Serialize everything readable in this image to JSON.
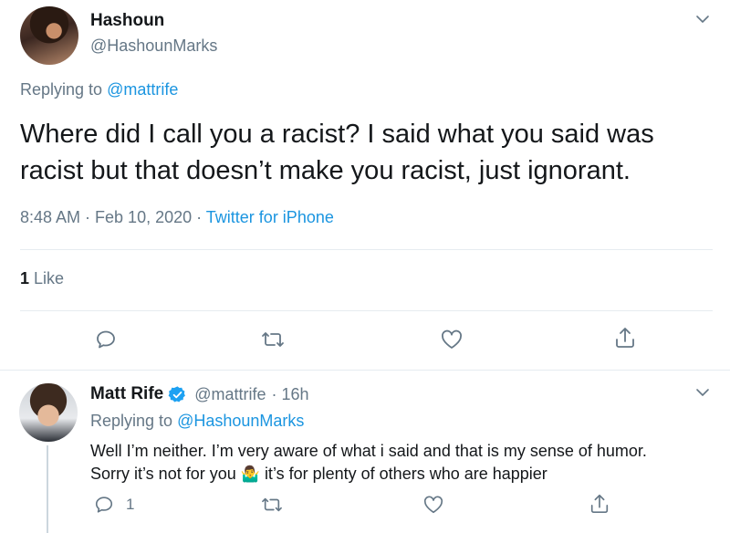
{
  "tweet": {
    "author_name": "Hashoun",
    "author_handle": "@HashounMarks",
    "replying_prefix": "Replying to",
    "replying_to": "@mattrife",
    "text_line1": "Where did I call you a racist? I said what you said was",
    "text_line2": "racist but that doesn’t make you racist, just ignorant.",
    "time": "8:48 AM · Feb 10, 2020 · ",
    "source": "Twitter for iPhone",
    "likes_count": "1",
    "likes_label": "Like"
  },
  "reply": {
    "author_name": "Matt Rife",
    "author_handle": "@mattrife",
    "age": "· 16h",
    "replying_prefix": "Replying to",
    "replying_to": "@HashounMarks",
    "text_line1": "Well I’m neither. I’m very aware of what i said and that is my sense of humor.",
    "text_line2a": "Sorry it’s not for you",
    "emoji": "🤷‍♂️",
    "text_line2b": "it’s for plenty of others who are happier",
    "reply_count": "1"
  },
  "colors": {
    "link": "#1b95e0",
    "secondary": "#657786",
    "verified": "#1da1f2",
    "divider": "#e6ecf0"
  },
  "icons": [
    "chevron-down-icon",
    "reply-icon",
    "retweet-icon",
    "like-icon",
    "share-icon",
    "verified-badge-icon"
  ]
}
